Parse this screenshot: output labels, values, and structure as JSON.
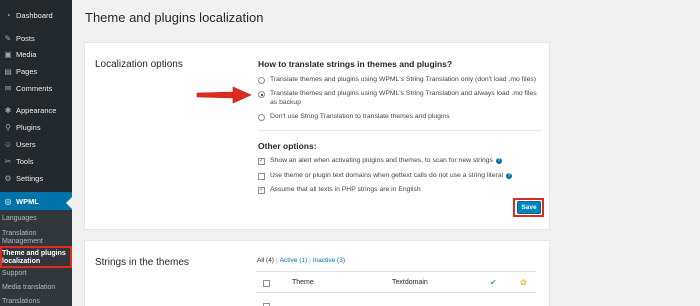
{
  "sidebar": {
    "items": [
      {
        "label": "Dashboard",
        "icon": "dashboard-icon",
        "glyph": "◔"
      },
      {
        "label": "Posts",
        "icon": "pushpin-icon",
        "glyph": "✎"
      },
      {
        "label": "Media",
        "icon": "media-icon",
        "glyph": "▣"
      },
      {
        "label": "Pages",
        "icon": "pages-icon",
        "glyph": "▤"
      },
      {
        "label": "Comments",
        "icon": "comments-icon",
        "glyph": "✉"
      },
      {
        "label": "Appearance",
        "icon": "appearance-icon",
        "glyph": "✱"
      },
      {
        "label": "Plugins",
        "icon": "plugins-icon",
        "glyph": "⚲"
      },
      {
        "label": "Users",
        "icon": "users-icon",
        "glyph": "☺"
      },
      {
        "label": "Tools",
        "icon": "tools-icon",
        "glyph": "✂"
      },
      {
        "label": "Settings",
        "icon": "settings-icon",
        "glyph": "⚙"
      },
      {
        "label": "WPML",
        "icon": "wpml-icon",
        "glyph": "◎"
      }
    ],
    "submenu": [
      {
        "label": "Languages"
      },
      {
        "label": "Translation Management"
      },
      {
        "label": "Theme and plugins localization"
      },
      {
        "label": "Support"
      },
      {
        "label": "Media translation"
      },
      {
        "label": "Translations"
      }
    ]
  },
  "page": {
    "title": "Theme and plugins localization"
  },
  "localization": {
    "section_label": "Localization options",
    "question": "How to translate strings in themes and plugins?",
    "radio_options": [
      {
        "label": "Translate themes and plugins using WPML's String Translation only (don't load .mo files)",
        "checked": false
      },
      {
        "label": "Translate themes and plugins using WPML's String Translation and always load .mo files as backup",
        "checked": true
      },
      {
        "label": "Don't use String Translation to translate themes and plugins",
        "checked": false
      }
    ],
    "other_title": "Other options:",
    "checkbox_options": [
      {
        "label": "Show an alert when activating plugins and themes, to scan for new strings",
        "checked": true,
        "help": true
      },
      {
        "label": "Use theme or plugin text domains when gettext calls do not use a string literal",
        "checked": false,
        "help": true
      },
      {
        "label": "Assume that all texts in PHP strings are in English",
        "checked": true,
        "help": false
      }
    ],
    "save_label": "Save"
  },
  "themes": {
    "section_label": "Strings in the themes",
    "filters": {
      "all": "All (4)",
      "active": "Active (1)",
      "inactive": "Inactive (3)",
      "sep": "|"
    },
    "columns": {
      "theme": "Theme",
      "textdomain": "Textdomain"
    },
    "icons": {
      "check": "✔",
      "status": "✿"
    }
  },
  "colors": {
    "accent": "#0073aa",
    "highlight": "#e12b1f",
    "sidebar": "#23282d"
  }
}
